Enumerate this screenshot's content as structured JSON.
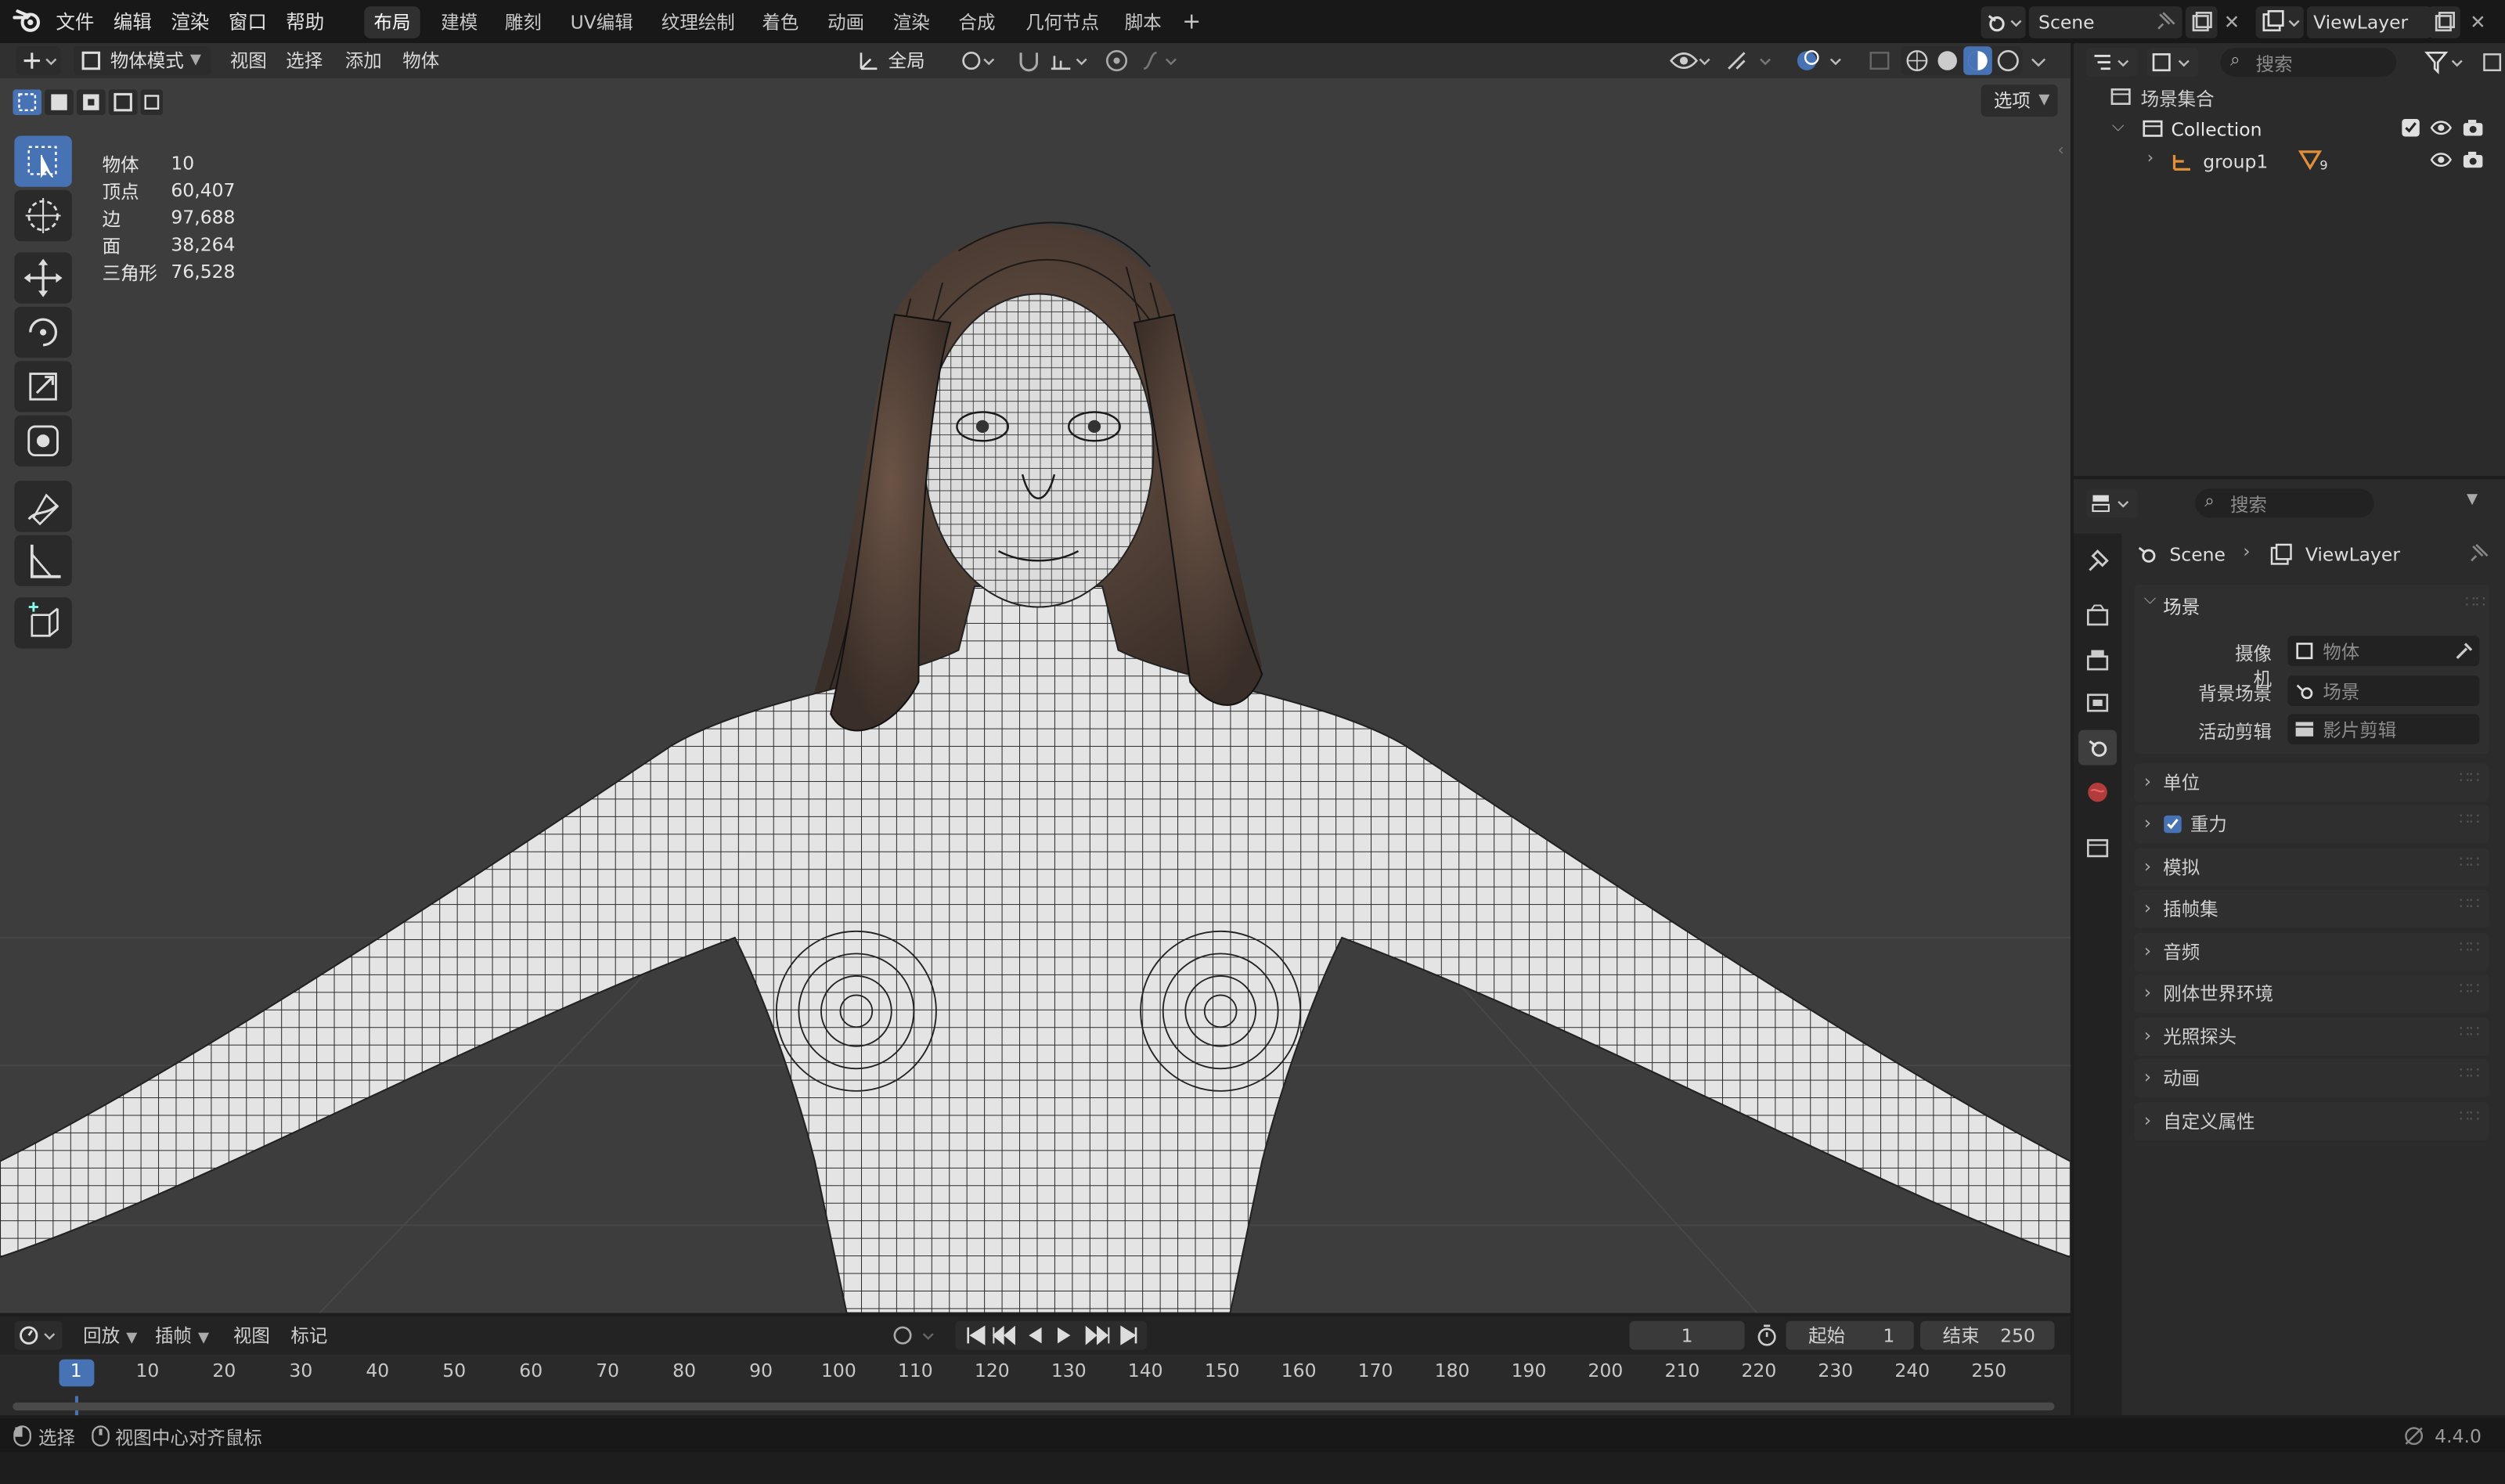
{
  "menu": {
    "file": "文件",
    "edit": "编辑",
    "render": "渲染",
    "window": "窗口",
    "help": "帮助"
  },
  "workspaces": [
    "布局",
    "建模",
    "雕刻",
    "UV编辑",
    "纹理绘制",
    "着色",
    "动画",
    "渲染",
    "合成",
    "几何节点",
    "脚本"
  ],
  "add_workspace": "+",
  "scene_field": "Scene",
  "viewlayer_field": "ViewLayer",
  "viewport": {
    "mode": "物体模式",
    "menus": [
      "视图",
      "选择",
      "添加",
      "物体"
    ],
    "transform_orientation": "全局",
    "options": "选项",
    "stats": {
      "labels": [
        "物体",
        "顶点",
        "边",
        "面",
        "三角形"
      ],
      "values": [
        "10",
        "60,407",
        "97,688",
        "38,264",
        "76,528"
      ]
    }
  },
  "outliner": {
    "search_placeholder": "搜索",
    "scene_collection": "场景集合",
    "collection": "Collection",
    "group": "group1",
    "group_badge": "9"
  },
  "properties": {
    "search_placeholder": "搜索",
    "breadcrumb_scene": "Scene",
    "breadcrumb_viewlayer": "ViewLayer",
    "panel_title": "场景",
    "camera_label": "摄像机",
    "camera_value": "物体",
    "background_label": "背景场景",
    "background_value": "场景",
    "clip_label": "活动剪辑",
    "clip_value": "影片剪辑",
    "sections": [
      "单位",
      "重力",
      "模拟",
      "插帧集",
      "音频",
      "刚体世界环境",
      "光照探头",
      "动画",
      "自定义属性"
    ]
  },
  "timeline": {
    "playback": "回放",
    "keying": "插帧",
    "view": "视图",
    "marker": "标记",
    "current_frame": "1",
    "start_label": "起始",
    "start_value": "1",
    "end_label": "结束",
    "end_value": "250",
    "ticks": [
      "1",
      "10",
      "20",
      "30",
      "40",
      "50",
      "60",
      "70",
      "80",
      "90",
      "100",
      "110",
      "120",
      "130",
      "140",
      "150",
      "160",
      "170",
      "180",
      "190",
      "200",
      "210",
      "220",
      "230",
      "240",
      "250"
    ]
  },
  "status": {
    "select": "选择",
    "center_view": "视图中心对齐鼠标",
    "version": "4.4.0"
  },
  "colors": {
    "accent": "#4772b3",
    "viewport_bg": "#3d3d3d",
    "panel_bg": "#2b2b2b",
    "header_bg": "#181818"
  }
}
